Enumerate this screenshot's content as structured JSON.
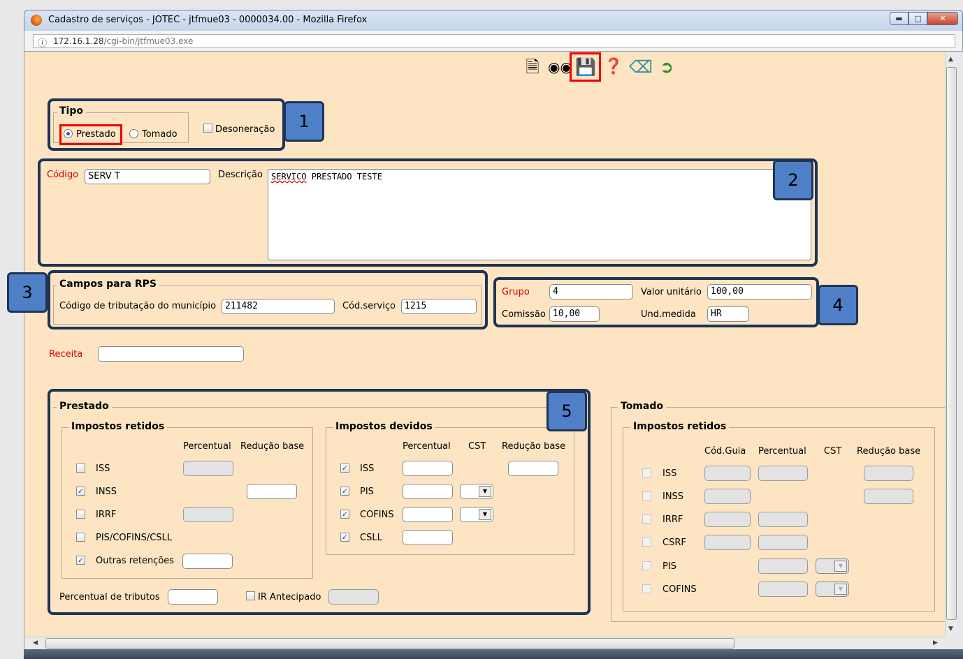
{
  "window": {
    "title": "Cadastro de serviços - JOTEC - jtfmue03 - 0000034.00 - Mozilla Firefox",
    "url_host": "172.16.1.28",
    "url_path": "/cgi-bin/jtfmue03.exe"
  },
  "toolbar": {
    "icons": [
      "new-document-icon",
      "binoculars-search-icon",
      "save-floppy-icon",
      "help-icon",
      "eraser-icon",
      "exit-door-icon"
    ]
  },
  "tipo": {
    "legend": "Tipo",
    "prestado_label": "Prestado",
    "tomado_label": "Tomado",
    "desoneracao_label": "Desoneração",
    "selected": "Prestado"
  },
  "codigo": {
    "codigo_label": "Código",
    "codigo_value": "SERV T",
    "descricao_label": "Descrição",
    "descricao_first_word": "SERVICO",
    "descricao_rest": " PRESTADO TESTE"
  },
  "rps": {
    "legend": "Campos para RPS",
    "cod_trib_label": "Código de tributação do município",
    "cod_trib_value": "211482",
    "cod_servico_label": "Cód.serviço",
    "cod_servico_value": "1215"
  },
  "grupo": {
    "grupo_label": "Grupo",
    "grupo_value": "4",
    "valor_label": "Valor unitário",
    "valor_value": "100,00",
    "comissao_label": "Comissão",
    "comissao_value": "10,00",
    "und_label": "Und.medida",
    "und_value": "HR"
  },
  "receita": {
    "label": "Receita",
    "value": ""
  },
  "prestado": {
    "legend": "Prestado",
    "retidos": {
      "legend": "Impostos retidos",
      "col_percentual": "Percentual",
      "col_reducao": "Redução base",
      "items": [
        {
          "label": "ISS",
          "checked": false
        },
        {
          "label": "INSS",
          "checked": true
        },
        {
          "label": "IRRF",
          "checked": false
        },
        {
          "label": "PIS/COFINS/CSLL",
          "checked": false
        },
        {
          "label": "Outras retenções",
          "checked": true
        }
      ]
    },
    "devidos": {
      "legend": "Impostos devidos",
      "col_percentual": "Percentual",
      "col_cst": "CST",
      "col_reducao": "Redução base",
      "items": [
        {
          "label": "ISS",
          "checked": true
        },
        {
          "label": "PIS",
          "checked": true
        },
        {
          "label": "COFINS",
          "checked": true
        },
        {
          "label": "CSLL",
          "checked": true
        }
      ]
    },
    "perc_tributos_label": "Percentual de tributos",
    "ir_antecipado_label": "IR Antecipado"
  },
  "tomado": {
    "legend": "Tomado",
    "retidos": {
      "legend": "Impostos retidos",
      "col_guia": "Cód.Guia",
      "col_percentual": "Percentual",
      "col_cst": "CST",
      "col_reducao": "Redução base",
      "items": [
        {
          "label": "ISS"
        },
        {
          "label": "INSS"
        },
        {
          "label": "IRRF"
        },
        {
          "label": "CSRF"
        },
        {
          "label": "PIS"
        },
        {
          "label": "COFINS"
        }
      ]
    }
  },
  "badges": [
    "1",
    "2",
    "3",
    "4",
    "5"
  ],
  "colors": {
    "page_background": "#fde5c3",
    "highlight_red": "#e00000",
    "badge_blue": "#4f7fc7",
    "frame_dark": "#1f3454"
  }
}
